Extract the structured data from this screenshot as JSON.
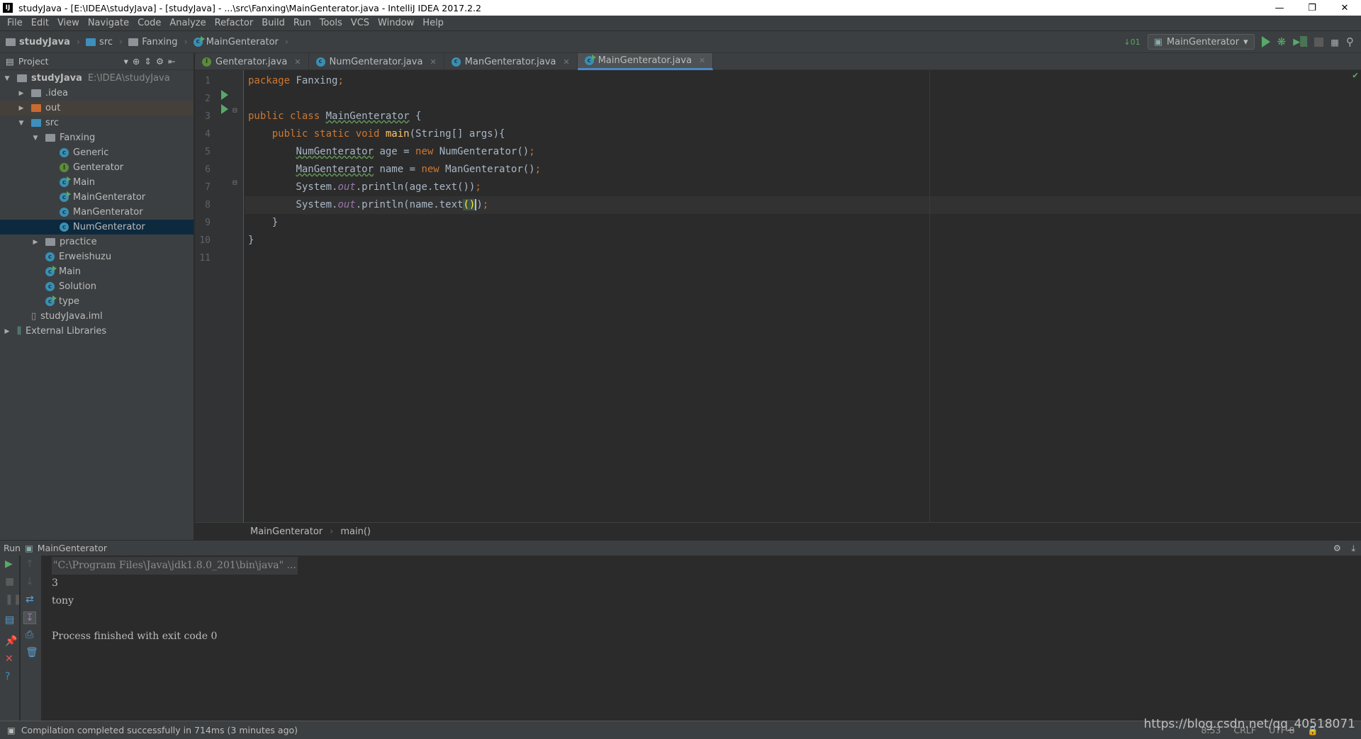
{
  "window": {
    "title": "studyJava - [E:\\IDEA\\studyJava] - [studyJava] - ...\\src\\Fanxing\\MainGenterator.java - IntelliJ IDEA 2017.2.2",
    "logo": "IJ"
  },
  "menu": [
    "File",
    "Edit",
    "View",
    "Navigate",
    "Code",
    "Analyze",
    "Refactor",
    "Build",
    "Run",
    "Tools",
    "VCS",
    "Window",
    "Help"
  ],
  "navbar": {
    "crumbs": [
      "studyJava",
      "src",
      "Fanxing",
      "MainGenterator"
    ],
    "run_config": "MainGenterator"
  },
  "project": {
    "title": "Project",
    "tree": [
      {
        "label": "studyJava",
        "path": "E:\\IDEA\\studyJava",
        "depth": 0,
        "arrow": "down",
        "icon": "module-folder"
      },
      {
        "label": ".idea",
        "depth": 1,
        "arrow": "right",
        "icon": "folder"
      },
      {
        "label": "out",
        "depth": 1,
        "arrow": "right",
        "icon": "folder-orange"
      },
      {
        "label": "src",
        "depth": 1,
        "arrow": "down",
        "icon": "folder-blue"
      },
      {
        "label": "Fanxing",
        "depth": 2,
        "arrow": "down",
        "icon": "package"
      },
      {
        "label": "Generic",
        "depth": 3,
        "icon": "class"
      },
      {
        "label": "Genterator",
        "depth": 3,
        "icon": "interface"
      },
      {
        "label": "Main",
        "depth": 3,
        "icon": "class-runnable"
      },
      {
        "label": "MainGenterator",
        "depth": 3,
        "icon": "class-runnable"
      },
      {
        "label": "ManGenterator",
        "depth": 3,
        "icon": "class"
      },
      {
        "label": "NumGenterator",
        "depth": 3,
        "icon": "class",
        "selected": true
      },
      {
        "label": "practice",
        "depth": 2,
        "arrow": "right",
        "icon": "package"
      },
      {
        "label": "Erweishuzu",
        "depth": 2,
        "icon": "class"
      },
      {
        "label": "Main",
        "depth": 2,
        "icon": "class-runnable"
      },
      {
        "label": "Solution",
        "depth": 2,
        "icon": "class"
      },
      {
        "label": "type",
        "depth": 2,
        "icon": "class-runnable"
      },
      {
        "label": "studyJava.iml",
        "depth": 1,
        "icon": "file"
      },
      {
        "label": "External Libraries",
        "depth": 0,
        "arrow": "right",
        "icon": "libraries"
      }
    ]
  },
  "tabs": [
    {
      "label": "Genterator.java",
      "icon": "interface"
    },
    {
      "label": "NumGenterator.java",
      "icon": "class"
    },
    {
      "label": "ManGenterator.java",
      "icon": "class"
    },
    {
      "label": "MainGenterator.java",
      "icon": "class-runnable",
      "active": true
    }
  ],
  "editor": {
    "line_numbers": [
      "1",
      "2",
      "3",
      "4",
      "5",
      "6",
      "7",
      "8",
      "9",
      "10",
      "11"
    ],
    "breadcrumb": [
      "MainGenterator",
      "main()"
    ]
  },
  "run": {
    "title": "Run",
    "config": "MainGenterator",
    "output": [
      "\"C:\\Program Files\\Java\\jdk1.8.0_201\\bin\\java\" ...",
      "3",
      "tony",
      "",
      "Process finished with exit code 0"
    ]
  },
  "status": {
    "message": "Compilation completed successfully in 714ms (3 minutes ago)",
    "position": "8:53",
    "line_sep": "CRLF",
    "encoding": "UTF-8"
  },
  "watermark": "https://blog.csdn.net/qq_40518071"
}
